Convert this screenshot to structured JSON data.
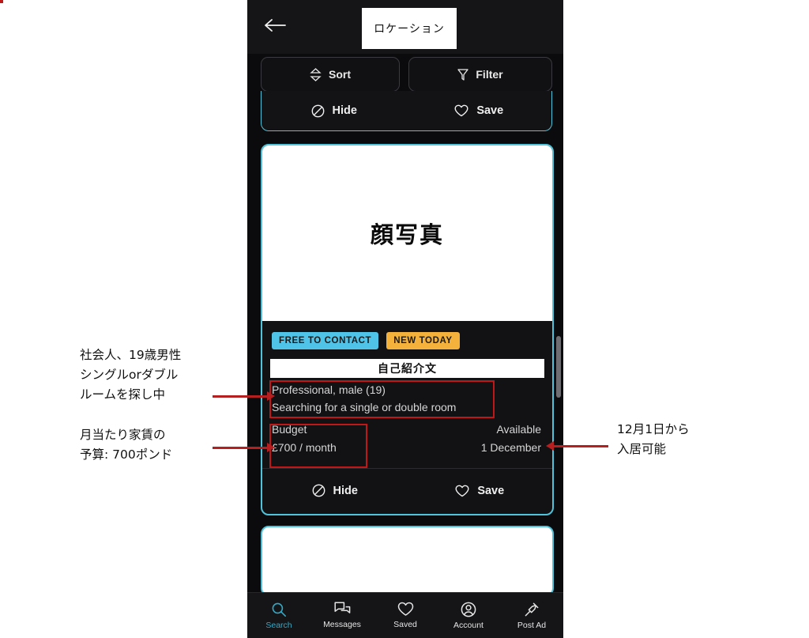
{
  "header": {
    "back_icon": "back-arrow-icon",
    "title_overlay": "ロケーション"
  },
  "toolbar": {
    "sort_label": "Sort",
    "filter_label": "Filter",
    "sort_icon": "sort-arrows-icon",
    "filter_icon": "funnel-icon"
  },
  "top_card": {
    "hide_label": "Hide",
    "save_label": "Save"
  },
  "listing": {
    "photo_placeholder": "顔写真",
    "badges": [
      {
        "label": "FREE TO CONTACT",
        "color": "#4fc3e8"
      },
      {
        "label": "NEW TODAY",
        "color": "#f4b13c"
      }
    ],
    "intro_header": "自己紹介文",
    "bio_line_1": "Professional, male (19)",
    "bio_line_2": "Searching for a single or double room",
    "budget_label": "Budget",
    "budget_value": "£700 / month",
    "available_label": "Available",
    "available_value": "1 December",
    "hide_label": "Hide",
    "save_label": "Save"
  },
  "bottom_nav": [
    {
      "label": "Search",
      "icon": "search-icon",
      "active": true
    },
    {
      "label": "Messages",
      "icon": "chat-icon",
      "active": false
    },
    {
      "label": "Saved",
      "icon": "heart-icon",
      "active": false
    },
    {
      "label": "Account",
      "icon": "person-icon",
      "active": false
    },
    {
      "label": "Post Ad",
      "icon": "pushpin-icon",
      "active": false
    }
  ],
  "annotations": {
    "left_1": "社会人、19歳男性\nシングルorダブル\nルームを探し中",
    "left_1_lines": [
      "社会人、19歳男性",
      "シングルorダブル",
      "ルームを探し中"
    ],
    "left_2_lines": [
      "月当たり家賃の",
      "予算: 700ポンド"
    ],
    "right_1_lines": [
      "12月1日から",
      "入居可能"
    ],
    "highlight_color": "#c01818",
    "arrow_color": "#b61f1f"
  },
  "colors": {
    "accent_cyan": "#4fc3d9",
    "nav_active": "#36a8c4",
    "phone_bg": "#0b0b0d"
  }
}
